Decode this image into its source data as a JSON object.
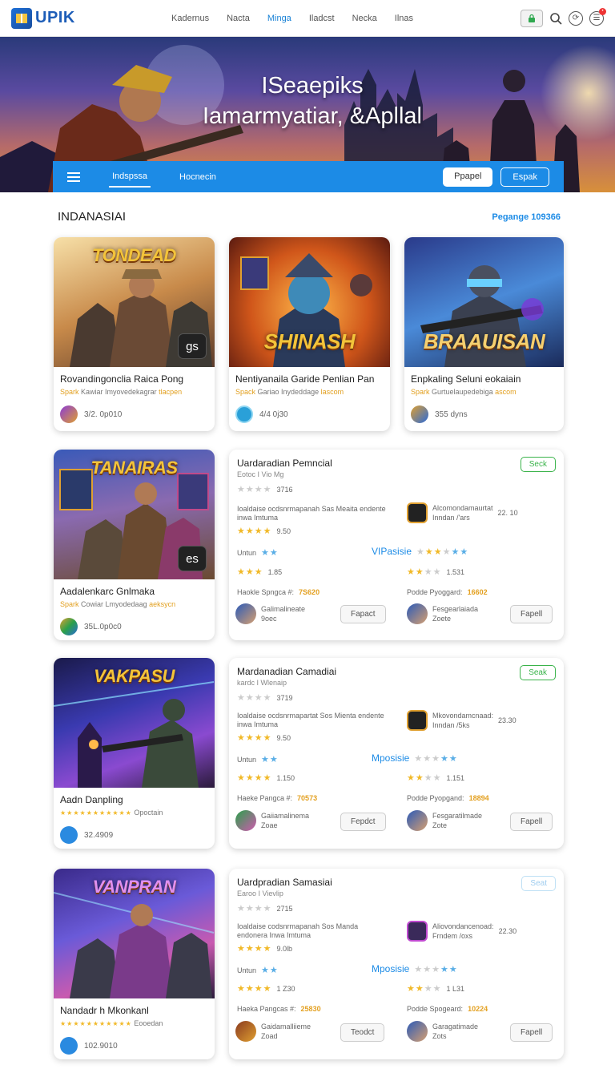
{
  "app": {
    "name": "UPIK"
  },
  "nav": {
    "links": [
      "Kadernus",
      "Nacta",
      "Minga",
      "Iladcst",
      "Necka",
      "Ilnas"
    ],
    "active": 2
  },
  "hero": {
    "title_line1": "ISeaepiks",
    "title_line2": "Iamarmyatiar, &Apllal",
    "tabs": [
      "Indspssa",
      "Hocnecin"
    ],
    "btn1": "Ppapel",
    "btn2": "Espak"
  },
  "section": {
    "title": "INDANASIAI",
    "link": "Pegange 109366"
  },
  "cards": [
    {
      "art_title": "TONDEAD",
      "name": "Rovandingonclia Raica Pong",
      "sub1": "Spark",
      "sub2": "Kawiar Imyovedekagrar",
      "sub3": "tlacpen",
      "foot": "3/2. 0p010",
      "badge": "gs"
    },
    {
      "art_title": "SHINASH",
      "name": "Nentiyanaila Garide Penlian Pan",
      "sub1": "Spack",
      "sub2": "Gariao Inydeddage",
      "sub3": "lascom",
      "foot": "4/4 0j30"
    },
    {
      "art_title": "BRAAUISAN",
      "name": "Enpkaling Seluni eokaiain",
      "sub1": "Spark",
      "sub2": "Gurtuelaupedebiga",
      "sub3": "ascom",
      "foot": "355 dyns"
    },
    {
      "art_title": "TANAIRAS",
      "name": "Aadalenkarc Gnlmaka",
      "sub1": "Spark",
      "sub2": "Cowiar Lmyodedaag",
      "sub3": "aeksycn",
      "foot": "35L.0p0c0",
      "badge": "es"
    },
    {
      "art_title": "VAKPASU",
      "name": "Aadn Danpling",
      "sub2": "Opoctain",
      "foot": "32.4909"
    },
    {
      "art_title": "VANPRAN",
      "name": "Nandadr h Mkonkanl",
      "sub2": "Eooedan",
      "foot": "102.9010"
    }
  ],
  "details": [
    {
      "title": "Uardaradian Pemncial",
      "sub": "Eotoc I Vio Mg",
      "btn": "Seck",
      "rating": "3716",
      "text": "Ioaldaise ocdsnrmapanah Sas Meaita endente inwa Imtuma",
      "score1": "9.50",
      "app_name": "Alcomondamaurtat",
      "app_sub": "Inndan /'ars",
      "app_price": "22. 10",
      "label_left": "Untun",
      "label_right": "VIPasisie",
      "score2": "1.85",
      "score3": "1.531",
      "prog_left": "Haokle Spngca #:",
      "prog_left_val": "7S620",
      "prog_right": "Podde Pyoggard:",
      "prog_right_val": "16602",
      "user_left": "Galimalineate",
      "user_left_sub": "9oec",
      "btn_left": "Fapact",
      "user_right": "Fesgearlaiada",
      "user_right_sub": "Zoete",
      "btn_right": "Fapell"
    },
    {
      "title": "Mardanadian Camadiai",
      "sub": "kardc I Wlenaip",
      "btn": "Seak",
      "rating": "3719",
      "text": "Ioaldaise ocdsnrmapartat Sos Mienta endente inwa Imtuma",
      "score1": "9.50",
      "app_name": "Mkovondamcnaad:",
      "app_sub": "Inndan /5ks",
      "app_price": "23.30",
      "label_left": "Untun",
      "label_right": "Mposisie",
      "score2": "1.150",
      "score3": "1.151",
      "prog_left": "Haeke Pangca #:",
      "prog_left_val": "70573",
      "prog_right": "Podde Pyopgand:",
      "prog_right_val": "18894",
      "user_left": "Gaiiamalinema",
      "user_left_sub": "Zoae",
      "btn_left": "Fepdct",
      "user_right": "Fesgaratilmade",
      "user_right_sub": "Zote",
      "btn_right": "Fapell"
    },
    {
      "title": "Uardpradian Samasiai",
      "sub": "Earoo I Vievlip",
      "btn": "Seat",
      "rating": "2715",
      "text": "Ioaldaise codsnrmapanah Sos Manda endonera Inwa Imtuma",
      "score1": "9.0lb",
      "app_name": "Aliovondancenoad:",
      "app_sub": "Frndem /oxs",
      "app_price": "22.30",
      "label_left": "Untun",
      "label_right": "Mposisie",
      "score2": "1 Z30",
      "score3": "1 L31",
      "prog_left": "Haeka Pangcas #:",
      "prog_left_val": "25830",
      "prog_right": "Podde Spogeard:",
      "prog_right_val": "10224",
      "user_left": "Gaidamalliieme",
      "user_left_sub": "Zoad",
      "btn_left": "Teodct",
      "user_right": "Garagatimade",
      "user_right_sub": "Zots",
      "btn_right": "Fapell"
    }
  ]
}
